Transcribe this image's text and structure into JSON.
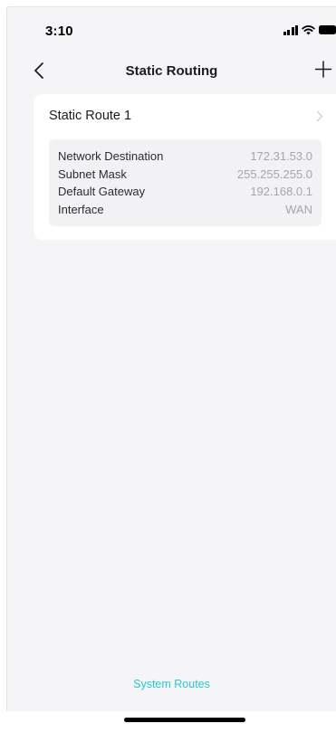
{
  "status_bar": {
    "time": "3:10",
    "icons": [
      "signal-icon",
      "wifi-icon",
      "battery-icon"
    ]
  },
  "nav": {
    "title": "Static Routing",
    "back_icon": "chevron-left-icon",
    "add_icon": "plus-icon"
  },
  "routes": [
    {
      "title": "Static Route 1",
      "details": [
        {
          "label": "Network Destination",
          "value": "172.31.53.0"
        },
        {
          "label": "Subnet Mask",
          "value": "255.255.255.0"
        },
        {
          "label": "Default Gateway",
          "value": "192.168.0.1"
        },
        {
          "label": "Interface",
          "value": "WAN"
        }
      ]
    }
  ],
  "footer": {
    "system_routes_label": "System Routes"
  },
  "colors": {
    "accent": "#2dc6d6",
    "background": "#f5f5f7",
    "card": "#ffffff",
    "detail_box": "#f2f2f4",
    "value_text": "#a6a6ab"
  }
}
